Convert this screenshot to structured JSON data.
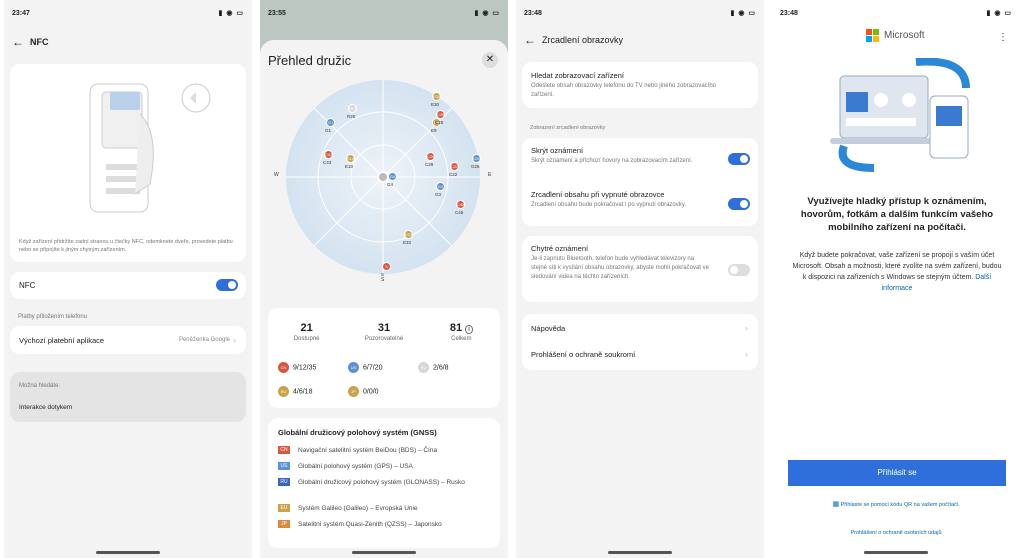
{
  "s1": {
    "time": "23:47",
    "title": "NFC",
    "desc": "Když zařízení přidržíte zadní stranou u čtečky NFC, odemknete dveře, provedete platbu nebo se připojíte k jiným chytrým zařízením.",
    "nfc_label": "NFC",
    "section": "Platby přiložením telefonu",
    "pay_label": "Výchozí platební aplikace",
    "pay_value": "Peněženka Google",
    "may_title": "Možná hledáte:",
    "may_item": "Interakce dotykem"
  },
  "s2": {
    "time": "23:55",
    "title": "Přehled družic",
    "compass": {
      "w": "W",
      "e": "E",
      "s": "S"
    },
    "sats": [
      {
        "id": "E30",
        "c": "#c9a24a"
      },
      {
        "id": "R20",
        "c": "#d6d6d6"
      },
      {
        "id": "G1",
        "c": "#5b8fd6"
      },
      {
        "id": "E9",
        "c": "#c9a24a"
      },
      {
        "id": "C28",
        "c": "#d9573f"
      },
      {
        "id": "C43",
        "c": "#d9573f"
      },
      {
        "id": "E10",
        "c": "#c9a24a"
      },
      {
        "id": "C29",
        "c": "#d9573f"
      },
      {
        "id": "G26",
        "c": "#5b8fd6"
      },
      {
        "id": "C22",
        "c": "#d9573f"
      },
      {
        "id": "G4",
        "c": "#5b8fd6"
      },
      {
        "id": "G3",
        "c": "#5b8fd6"
      },
      {
        "id": "C45",
        "c": "#d9573f"
      },
      {
        "id": "E33",
        "c": "#c9a24a"
      },
      {
        "id": "S",
        "c": "#d9573f"
      }
    ],
    "stats": [
      {
        "value": "21",
        "label": "Dostupné"
      },
      {
        "value": "31",
        "label": "Pozorovatelné"
      },
      {
        "value": "81",
        "label": "Celkem"
      }
    ],
    "counts": [
      {
        "flag": "CN",
        "color": "#d9573f",
        "value": "9/12/35"
      },
      {
        "flag": "US",
        "color": "#5b8fd6",
        "value": "6/7/20"
      },
      {
        "flag": "RU",
        "color": "#d6d6d6",
        "value": "2/6/8"
      },
      {
        "flag": "EU",
        "color": "#c9a24a",
        "value": "4/6/18"
      },
      {
        "flag": "JP",
        "color": "#c9a24a",
        "value": "0/0/0"
      }
    ],
    "gnss_title": "Globální družicový polohový systém (GNSS)",
    "gnss": [
      {
        "flag": "CN",
        "color": "#d9573f",
        "text": "Navigační satelitní systém BeiDou (BDS) – Čína"
      },
      {
        "flag": "US",
        "color": "#5b8fd6",
        "text": "Globální polohový systém (GPS) – USA"
      },
      {
        "flag": "RU",
        "color": "#3b63c4",
        "text": "Globální družicový polohový systém (GLONASS) – Rusko"
      },
      {
        "flag": "EU",
        "color": "#c9a24a",
        "text": "Systém Galileo (Galileo) – Evropská Unie"
      },
      {
        "flag": "JP",
        "color": "#d98a3f",
        "text": "Satelitní systém Quasi-Zenith (QZSS) – Japonsko"
      }
    ]
  },
  "s3": {
    "time": "23:48",
    "title": "Zrcadlení obrazovky",
    "find_title": "Hledat zobrazovací zařízení",
    "find_desc": "Odešlete obsah obrazovky telefonu do TV nebo jiného zobrazovacího zařízení.",
    "section": "Zobrazení zrcadlení obrazovky",
    "hide_title": "Skrýt oznámení",
    "hide_desc": "Skrýt oznámení a příchozí hovory na zobrazovacím zařízení.",
    "mirror_title": "Zrcadlení obsahu při vypnuté obrazovce",
    "mirror_desc": "Zrcadlení obsahu bude pokračovat i po vypnutí obrazovky.",
    "smart_title": "Chytré oznámení",
    "smart_desc": "Je-li zapnuto Bluetooth, telefon bude vyhledávat televizory na stejné síti k vysílání obsahu obrazovky, abyste mohli pokračovat ve sledování videa na těchto zařízeních.",
    "help": "Nápověda",
    "privacy": "Prohlášení o ochraně soukromí"
  },
  "s4": {
    "time": "23:48",
    "brand": "Microsoft",
    "headline": "Využívejte hladký přístup k oznámením, hovorům, fotkám a dalším funkcím vašeho mobilního zařízení na počítači.",
    "body": "Když budete pokračovat, vaše zařízení se propojí s vaším účet Microsoft. Obsah a možnosti, které zvolíte na svém zařízení, budou k dispozici na zařízeních s Windows se stejným účtem.",
    "link": "Další informace",
    "signin": "Přihlásit se",
    "qr": "Přihlaste se pomocí kódu QR na vašem počítači.",
    "privacy": "Prohlášení o ochraně osobních údajů"
  }
}
